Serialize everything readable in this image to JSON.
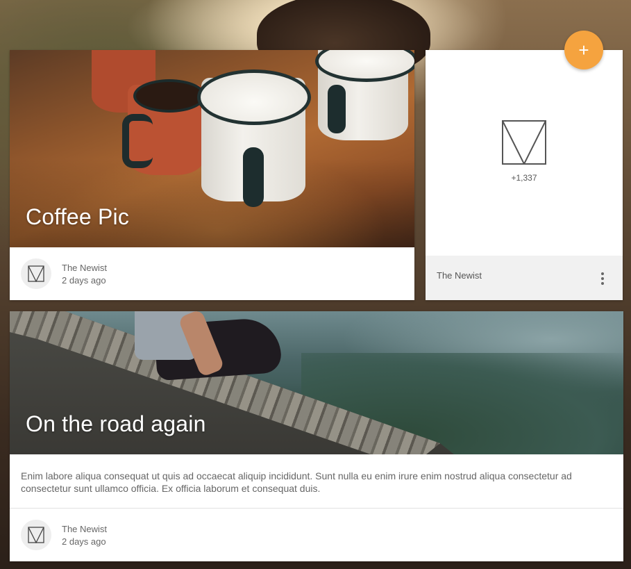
{
  "fab": {
    "icon": "plus-icon",
    "label": "+",
    "color": "#f5a33f"
  },
  "cards": {
    "coffee": {
      "title": "Coffee Pic",
      "author": "The Newist",
      "date": "2 days ago",
      "avatar_icon": "newist-logo-icon"
    },
    "side": {
      "logo_icon": "newist-logo-icon",
      "count": "+1,337",
      "author": "The Newist",
      "menu_icon": "more-vert-icon"
    },
    "road": {
      "title": "On the road again",
      "body": "Enim labore aliqua consequat ut quis ad occaecat aliquip incididunt. Sunt nulla eu enim irure enim nostrud aliqua consectetur ad consectetur sunt ullamco officia. Ex officia laborum et consequat duis.",
      "author": "The Newist",
      "date": "2 days ago",
      "avatar_icon": "newist-logo-icon"
    }
  }
}
